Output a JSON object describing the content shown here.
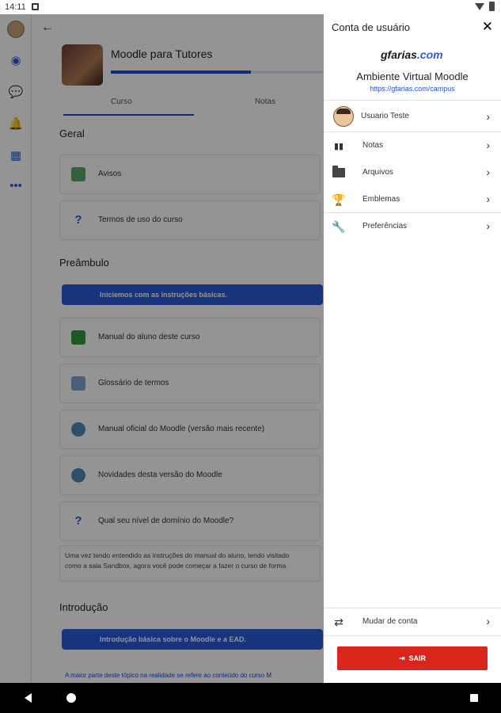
{
  "status_bar": {
    "time": "14:11"
  },
  "course": {
    "title": "Moodle para Tutores",
    "progress_fraction": 0.66,
    "tabs": [
      "Curso",
      "Notas"
    ]
  },
  "sections": [
    {
      "title": "Geral"
    },
    {
      "title": "Preâmbulo"
    },
    {
      "title": "Introdução"
    }
  ],
  "activities": [
    {
      "label": "Avisos",
      "icon": "forum-icon"
    },
    {
      "label": "Termos de uso do curso",
      "icon": "question-icon"
    },
    {
      "label": "Manual do aluno deste curso",
      "icon": "book-icon"
    },
    {
      "label": "Glossário de termos",
      "icon": "glossary-icon"
    },
    {
      "label": "Manual oficial do Moodle (versão mais recente)",
      "icon": "url-icon"
    },
    {
      "label": "Novidades desta versão do Moodle",
      "icon": "url-icon"
    },
    {
      "label": "Qual seu nível de domínio do Moodle?",
      "icon": "question-icon"
    }
  ],
  "banners": {
    "preamble": "Iniciemos com as instruções básicas.",
    "intro": "Introdução básica sobre o Moodle e a EAD."
  },
  "paragraph": {
    "line1": "Uma vez tendo entendido as instruções do manual do aluno, tendo visitado",
    "line2": "como a sala Sandbox, agora você pode começar a fazer o curso de forma"
  },
  "intro_link": "A maior parte deste tópico na realidade se refere ao conteúdo do curso M",
  "drawer": {
    "title": "Conta de usuário",
    "logo_text_main": "gfarias",
    "logo_text_suffix": ".com",
    "site_name": "Ambiente Virtual Moodle",
    "site_url": "https://gfarias.com/campus",
    "user_name": "Usuario Teste",
    "menu": [
      {
        "label": "Notas",
        "icon": "grades-icon"
      },
      {
        "label": "Arquivos",
        "icon": "folder-icon"
      },
      {
        "label": "Emblemas",
        "icon": "trophy-icon"
      },
      {
        "label": "Preferências",
        "icon": "wrench-icon"
      }
    ],
    "switch_account": "Mudar de conta",
    "logout": "SAIR"
  }
}
